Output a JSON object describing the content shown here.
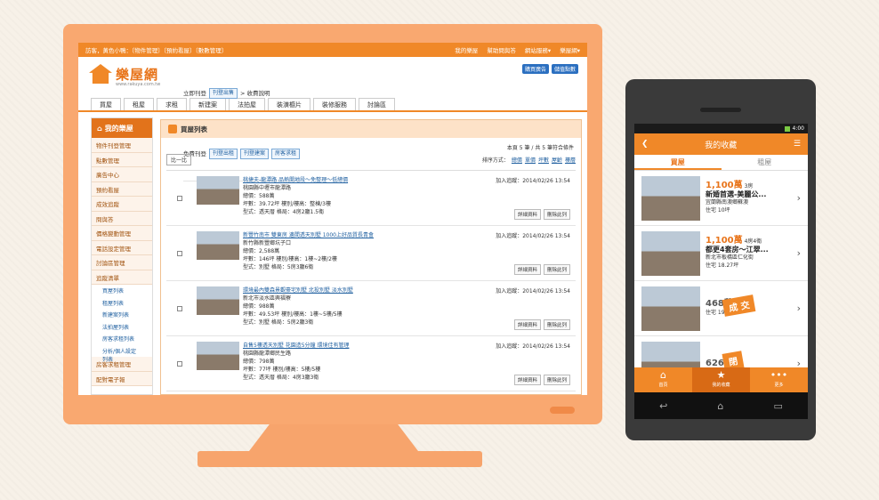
{
  "desktop": {
    "topbar": {
      "left": "訪客，黃色小鴨：〔物件管理〕〔預約看屋〕〔數數管理〕",
      "right": [
        "我的樂屋",
        "幫助問與答",
        "網站服務▾",
        "樂屋網▾"
      ]
    },
    "logo": {
      "name": "樂屋網",
      "url": "www.rakuya.com.tw"
    },
    "quick": {
      "row1_label": "立即刊登",
      "row1_btn": "刊登出售",
      "row1_note": "> 收費說明",
      "row2_label": "免費刊登",
      "row2_btns": [
        "刊登出租",
        "刊登建案",
        "房客求租"
      ]
    },
    "header_buttons": [
      "購買廣告",
      "儲值點數"
    ],
    "nav": [
      "買屋",
      "租屋",
      "求租",
      "新建案",
      "法拍屋",
      "裝潢櫥片",
      "裝修服務",
      "討論區"
    ],
    "sidebar": {
      "title": "我的樂屋",
      "items": [
        "物件刊登管理",
        "點數管理",
        "廣告中心",
        "預約看屋",
        "成效追蹤",
        "問與答",
        "價格變動管理",
        "電話設定管理",
        "討論區管理",
        "追蹤清單"
      ],
      "subitems": [
        "買屋列表",
        "租屋列表",
        "新建案列表",
        "法拍屋列表",
        "房客求租列表",
        "分析/個人設定列表"
      ],
      "items_after": [
        "房客求租管理",
        "配對電子報"
      ]
    },
    "main": {
      "title": "買屋列表",
      "meta": "本頁 5 筆 / 共 5 筆符合條件",
      "compare": "比一比",
      "sort_label": "排序方式：",
      "sort_options": [
        "總價",
        "單價",
        "坪數",
        "屋齡",
        "樓層"
      ],
      "listings": [
        {
          "title": "桃捷夫-龍潭路 品熱開地段～免整理～低總價",
          "loc": "桃園縣中壢市龍潭路",
          "price": "總價：588萬",
          "area": "坪數：39.72坪  樓別/樓高：整棟/3樓",
          "type": "型式：透天厝  格局：4房2廳1.5衛",
          "added": "加入追蹤：2014/02/26 13:54"
        },
        {
          "title": "新豐竹南市 雙東房 邊間透天別墅 1000上好品質長青會",
          "loc": "新竹縣新豐鄉坑子口",
          "price": "總價：2,588萬",
          "area": "坪數：146坪  樓別/樓高：1樓~2樓/2樓",
          "type": "型式：別墅  格局：5房3廳6衛",
          "added": "加入追蹤：2014/02/26 13:54"
        },
        {
          "title": "環境最內雙森景觀豪宅別墅 北投別墅 淡水別墅",
          "loc": "新北市淡水區興福寮",
          "price": "總價：988萬",
          "area": "坪數：49.53坪  樓別/樓高：1樓~5樓/5樓",
          "type": "型式：別墅  格局：5房2廳3衛",
          "added": "加入追蹤：2014/02/26 13:54"
        },
        {
          "title": "自售5樓透天別墅 花園造5分鐘 環境佳有管理",
          "loc": "桃園縣龍潭鄉民生路",
          "price": "總價：798萬",
          "area": "坪數：77坪  樓別/樓高：5樓/5樓",
          "type": "型式：透天厝  格局：4房3廳3衛",
          "added": "加入追蹤：2014/02/26 13:54"
        }
      ],
      "btn_detail": "詳細資料",
      "btn_delete": "刪除此列"
    }
  },
  "mobile": {
    "status_time": "4:00",
    "title": "我的收藏",
    "tabs": [
      "買屋",
      "租屋"
    ],
    "items": [
      {
        "price": "1,100萬",
        "rooms": "3房",
        "title": "新婚首選-美麗公...",
        "loc": "宜蘭縣南澳鄉蘇澳",
        "area": "住宅  10坪",
        "stamp": ""
      },
      {
        "price": "1,100萬",
        "rooms": "4房4衛",
        "title": "都更4套房～江翠...",
        "loc": "新北市板橋區仁化街",
        "area": "住宅  18.27坪",
        "stamp": ""
      },
      {
        "price": "468萬",
        "rooms": "",
        "title": "",
        "loc": "",
        "area": "住宅  19.49坪",
        "stamp": "成 交"
      },
      {
        "price": "626萬",
        "rooms": "",
        "title": "",
        "loc": "",
        "area": "",
        "stamp": "閉"
      }
    ],
    "bottom_nav": [
      {
        "icon": "home-icon",
        "label": "首頁"
      },
      {
        "icon": "star-icon",
        "label": "我的收藏"
      },
      {
        "icon": "more-icon",
        "label": "更多"
      }
    ]
  },
  "colors": {
    "accent": "#f08828",
    "link": "#2060a0"
  }
}
